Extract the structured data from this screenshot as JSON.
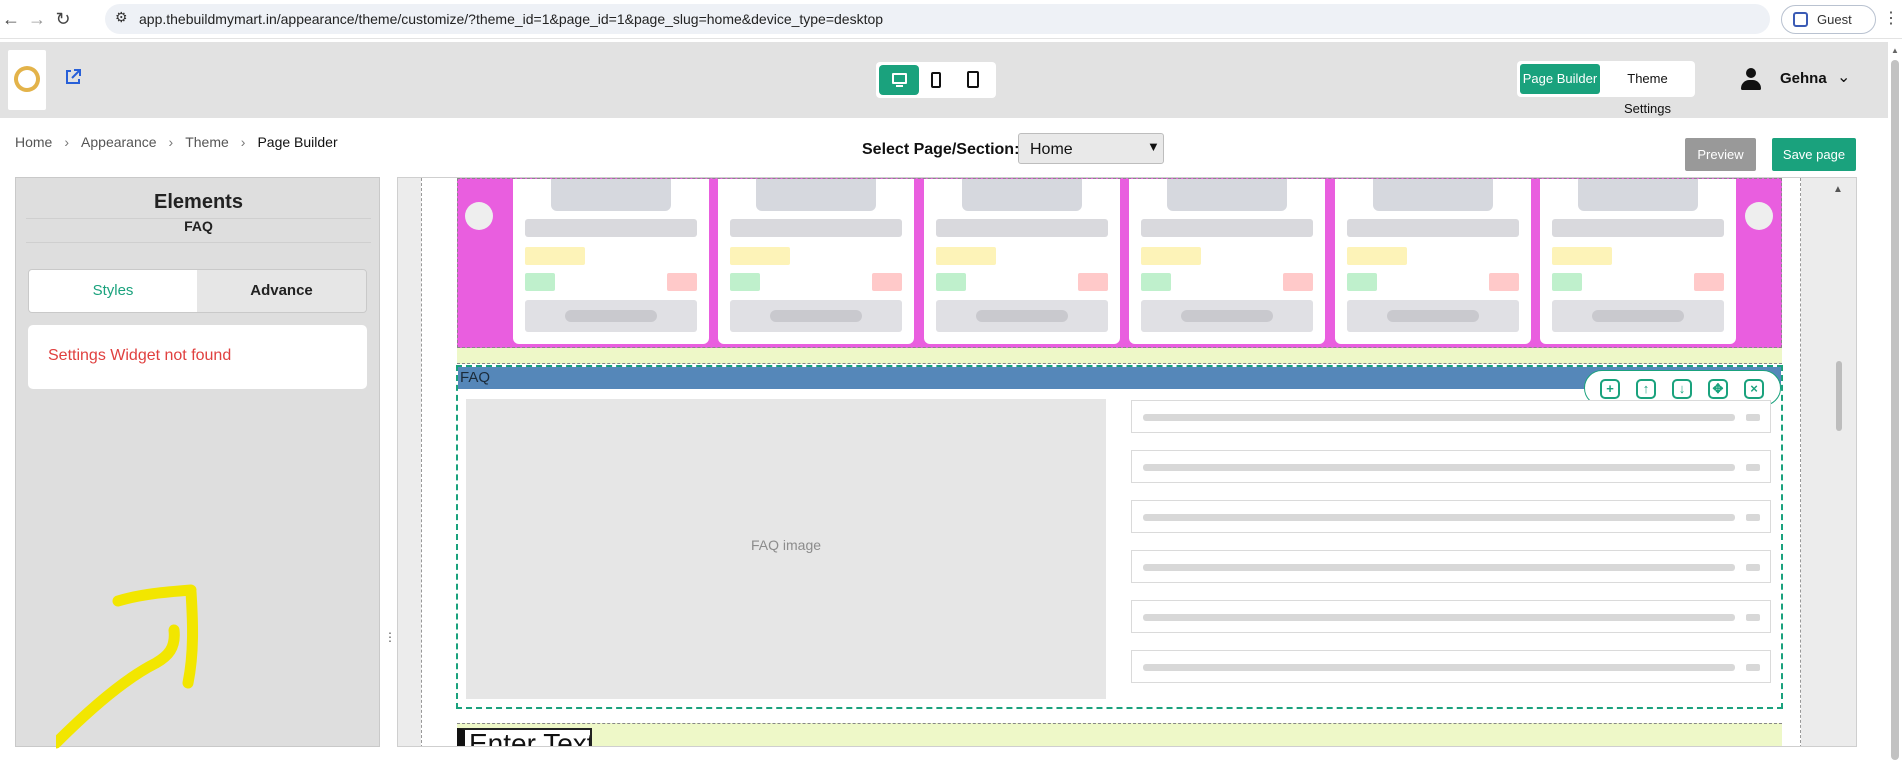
{
  "browser": {
    "url": "app.thebuildmymart.in/appearance/theme/customize/?theme_id=1&page_id=1&page_slug=home&device_type=desktop",
    "profile_label": "Guest",
    "icons": [
      "back-icon",
      "forward-icon",
      "reload-icon",
      "site-info-icon",
      "more-menu-icon"
    ]
  },
  "header": {
    "mode_tabs": {
      "page_builder": "Page Builder",
      "theme_settings": "Theme Settings"
    },
    "active_device": "desktop",
    "user_name": "Gehna"
  },
  "breadcrumb": [
    "Home",
    "Appearance",
    "Theme",
    "Page Builder"
  ],
  "page_select": {
    "label": "Select Page/Section:",
    "value": "Home"
  },
  "actions": {
    "preview": "Preview",
    "save": "Save page"
  },
  "sidebar": {
    "title": "Elements",
    "subtitle": "FAQ",
    "tabs": {
      "styles": "Styles",
      "advance": "Advance"
    },
    "active_tab": "Styles",
    "message": "Settings Widget not found"
  },
  "canvas": {
    "product_cards_count": 6,
    "faq_label": "FAQ",
    "faq_image_placeholder": "FAQ image",
    "faq_items_count": 6,
    "text_widget_placeholder": "Enter Text",
    "section_toolbar": [
      "duplicate-icon",
      "move-up-icon",
      "move-down-icon",
      "drag-move-icon",
      "close-icon"
    ]
  },
  "colors": {
    "accent": "#1aa27d",
    "danger": "#e0403f",
    "product_band": "#e95edf",
    "faq_bar": "#5587b9",
    "annotation": "#f2e600"
  }
}
